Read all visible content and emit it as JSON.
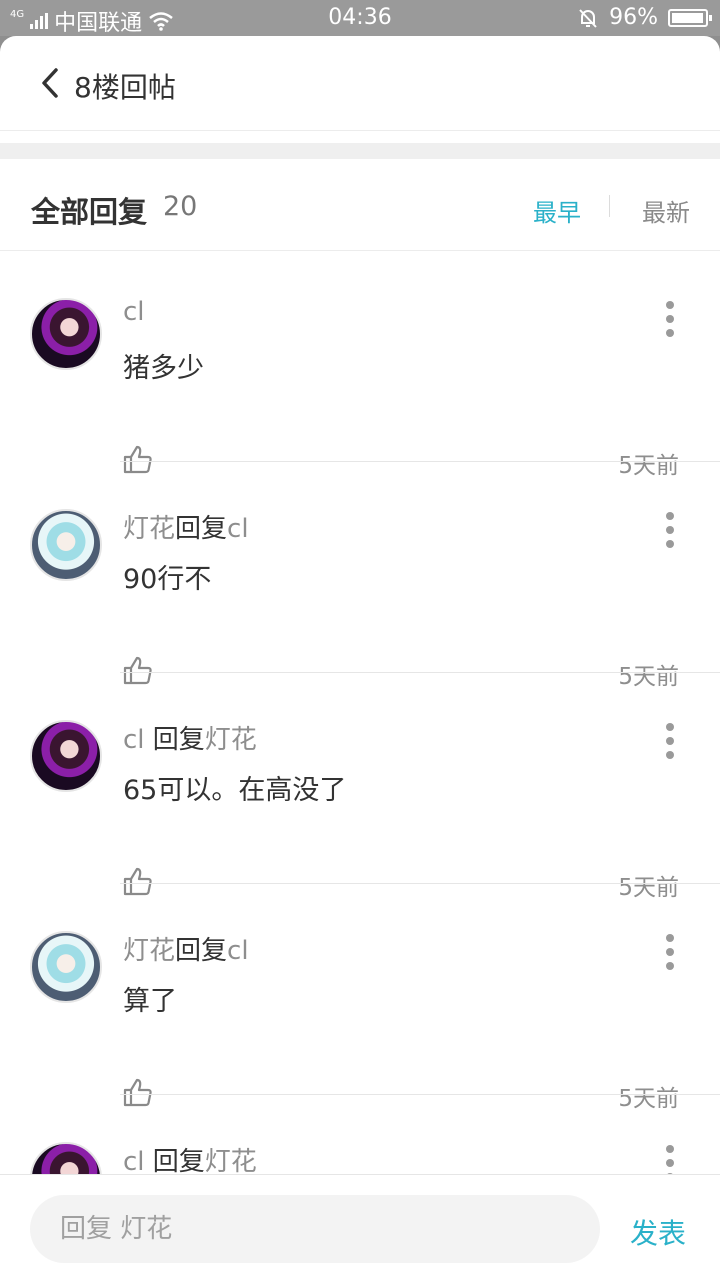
{
  "status_bar": {
    "network_type": "4G",
    "carrier": "中国联通",
    "time": "04:36",
    "battery_percent": "96%",
    "battery_level": 0.96,
    "icons": [
      "signal-icon",
      "wifi-icon",
      "mute-icon",
      "battery-icon"
    ]
  },
  "header": {
    "title": "8楼回帖",
    "back_icon": "back-arrow-icon"
  },
  "section": {
    "title": "全部回复",
    "count": "20",
    "sort_earliest": "最早",
    "sort_latest": "最新",
    "active_sort_color": "#2ab1c9"
  },
  "replies": [
    {
      "author": "cl",
      "reply_word": "",
      "target": "",
      "text": "猪多少",
      "time": "5天前"
    },
    {
      "author": "灯花",
      "reply_word": "回复",
      "target": "cl",
      "text": "90行不",
      "time": "5天前"
    },
    {
      "author": "cl",
      "reply_word": " 回复",
      "target": "灯花",
      "text": "65可以。在高没了",
      "time": "5天前"
    },
    {
      "author": "灯花",
      "reply_word": "回复",
      "target": "cl",
      "text": "算了",
      "time": "5天前"
    },
    {
      "author": "cl",
      "reply_word": " 回复",
      "target": "灯花",
      "text": "",
      "time": ""
    }
  ],
  "composer": {
    "placeholder": "回复 灯花",
    "send_label": "发表"
  }
}
